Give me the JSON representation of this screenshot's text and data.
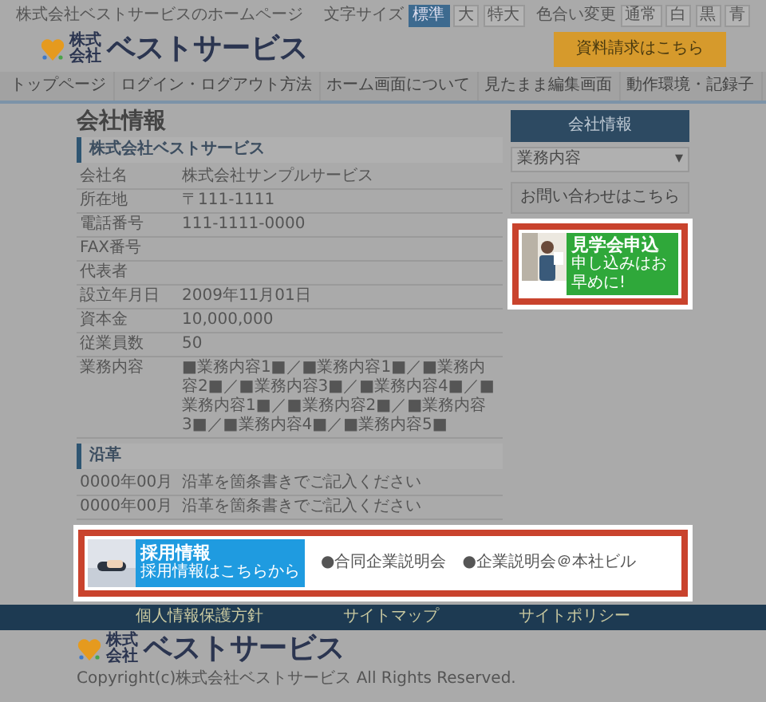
{
  "header": {
    "tagline": "株式会社ベストサービスのホームページ",
    "font_size": {
      "label": "文字サイズ",
      "options": [
        {
          "label": "標準",
          "selected": true
        },
        {
          "label": "大",
          "selected": false
        },
        {
          "label": "特大",
          "selected": false
        }
      ]
    },
    "color_scheme": {
      "label": "色合い変更",
      "options": [
        {
          "label": "通常",
          "selected": false
        },
        {
          "label": "白",
          "selected": false
        },
        {
          "label": "黒",
          "selected": false
        },
        {
          "label": "青",
          "selected": false
        }
      ]
    },
    "logo": {
      "small": "株式会社",
      "name": "ベストサービス"
    },
    "request_button": "資料請求はこちら"
  },
  "nav": [
    "トップページ",
    "ログイン・ログアウト方法",
    "ホーム画面について",
    "見たまま編集画面",
    "動作環境・記録子"
  ],
  "page_title": "会社情報",
  "company": {
    "heading": "株式会社ベストサービス",
    "rows": [
      {
        "label": "会社名",
        "value": "株式会社サンプルサービス"
      },
      {
        "label": "所在地",
        "value": "〒111-1111"
      },
      {
        "label": "電話番号",
        "value": "111-1111-0000"
      },
      {
        "label": "FAX番号"
      },
      {
        "label": "代表者"
      },
      {
        "label": "設立年月日",
        "value": "2009年11月01日"
      },
      {
        "label": "資本金",
        "value": "10,000,000"
      },
      {
        "label": "従業員数",
        "value": "50"
      },
      {
        "label": "業務内容",
        "value": "■業務内容1■／■業務内容1■／■業務内容2■／■業務内容3■／■業務内容4■／■業務内容1■／■業務内容2■／■業務内容3■／■業務内容4■／■業務内容5■"
      }
    ]
  },
  "history": {
    "heading": "沿革",
    "rows": [
      {
        "date": "0000年00月",
        "text": "沿革を箇条書きでご記入ください"
      },
      {
        "date": "0000年00月",
        "text": "沿革を箇条書きでご記入ください"
      }
    ]
  },
  "sidebar": {
    "heading": "会社情報",
    "select": "業務内容",
    "select_caret": "▾",
    "contact_button": "お問い合わせはこちら",
    "banner": {
      "title": "見学会申込",
      "subtitle": "申し込みはお早めに!",
      "highlighted": true
    }
  },
  "recruit": {
    "highlighted": true,
    "banner": {
      "title": "採用情報",
      "subtitle": "採用情報はこちらから"
    },
    "links": [
      "●合同企業説明会",
      "●企業説明会＠本社ビル"
    ]
  },
  "footer": {
    "links": [
      "個人情報保護方針",
      "サイトマップ",
      "サイトポリシー"
    ],
    "logo": {
      "small": "株式会社",
      "name": "ベストサービス"
    },
    "copyright": "Copyright(c)株式会社ベストサービス All Rights Reserved."
  }
}
